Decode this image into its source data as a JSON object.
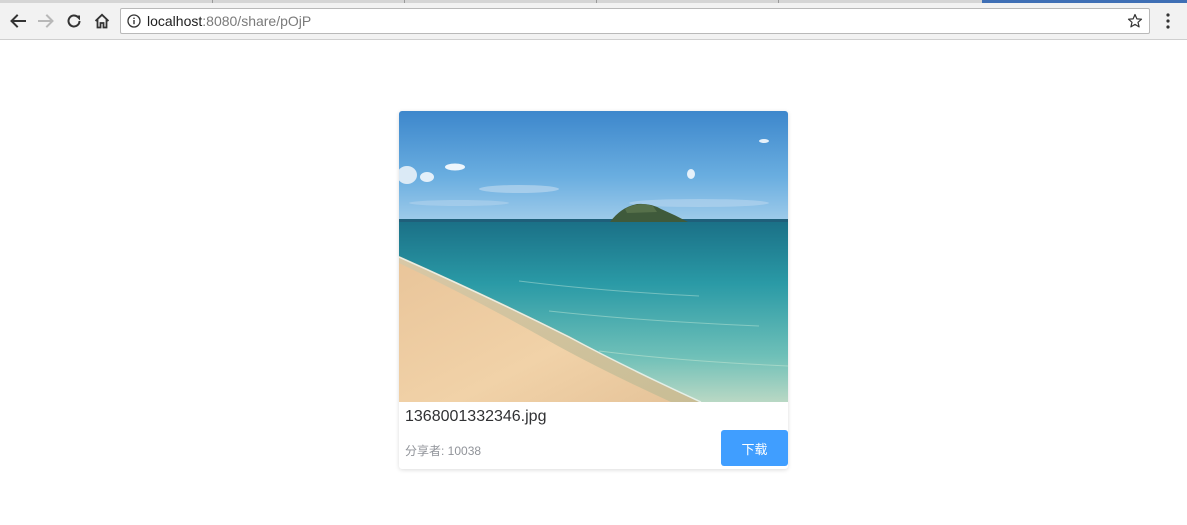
{
  "browser": {
    "url_host": "localhost",
    "url_rest": ":8080/share/pOjP",
    "icons": {
      "back": "back-arrow-icon",
      "forward": "forward-arrow-icon",
      "reload": "reload-icon",
      "home": "home-icon",
      "info": "info-icon",
      "bookmark": "star-icon",
      "menu": "kebab-menu-icon"
    },
    "colors": {
      "active_tab": "#3f6fb5",
      "toolbar": "#f2f2f2"
    }
  },
  "share": {
    "file_name": "1368001332346.jpg",
    "sharer_text": "分享者: 10038",
    "download_label": "下载",
    "image_subject": "beach-sea-island-photo"
  },
  "colors": {
    "primary_button": "#409eff",
    "secondary_text": "#909399",
    "primary_text": "#303133"
  }
}
